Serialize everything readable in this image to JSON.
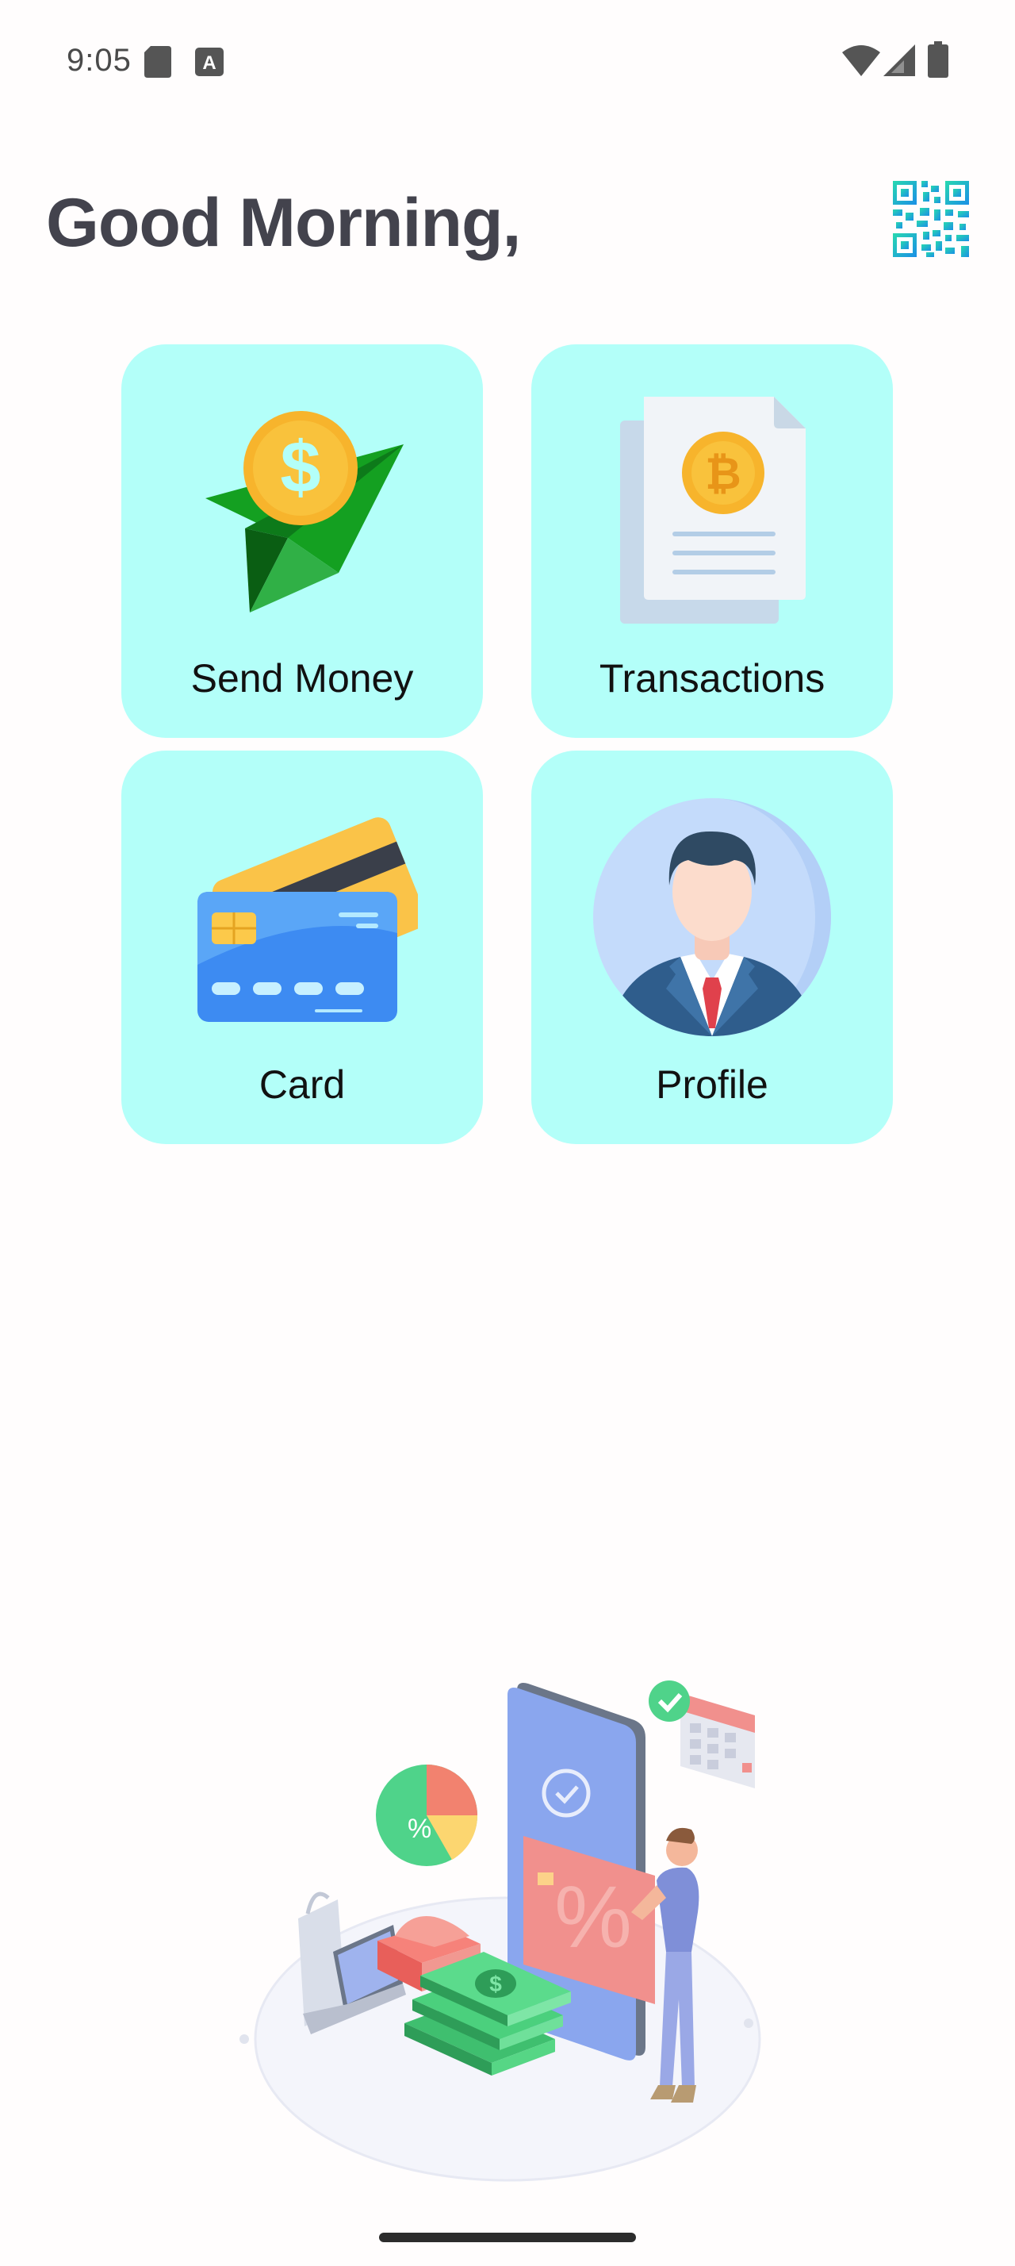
{
  "status_bar": {
    "time": "9:05",
    "icons": [
      "sd-card-icon",
      "keyboard-a-icon",
      "wifi-icon",
      "signal-icon",
      "battery-icon"
    ]
  },
  "header": {
    "greeting": "Good Morning,",
    "qr_icon": "qr-code-icon"
  },
  "tiles": [
    {
      "label": "Send Money",
      "icon": "send-money-icon"
    },
    {
      "label": "Transactions",
      "icon": "transactions-document-icon"
    },
    {
      "label": "Card",
      "icon": "credit-card-icon"
    },
    {
      "label": "Profile",
      "icon": "profile-avatar-icon"
    }
  ],
  "colors": {
    "tile_background": "#b3fff9",
    "greeting_text": "#43434d",
    "qr_accent": "#1fb6e8"
  }
}
